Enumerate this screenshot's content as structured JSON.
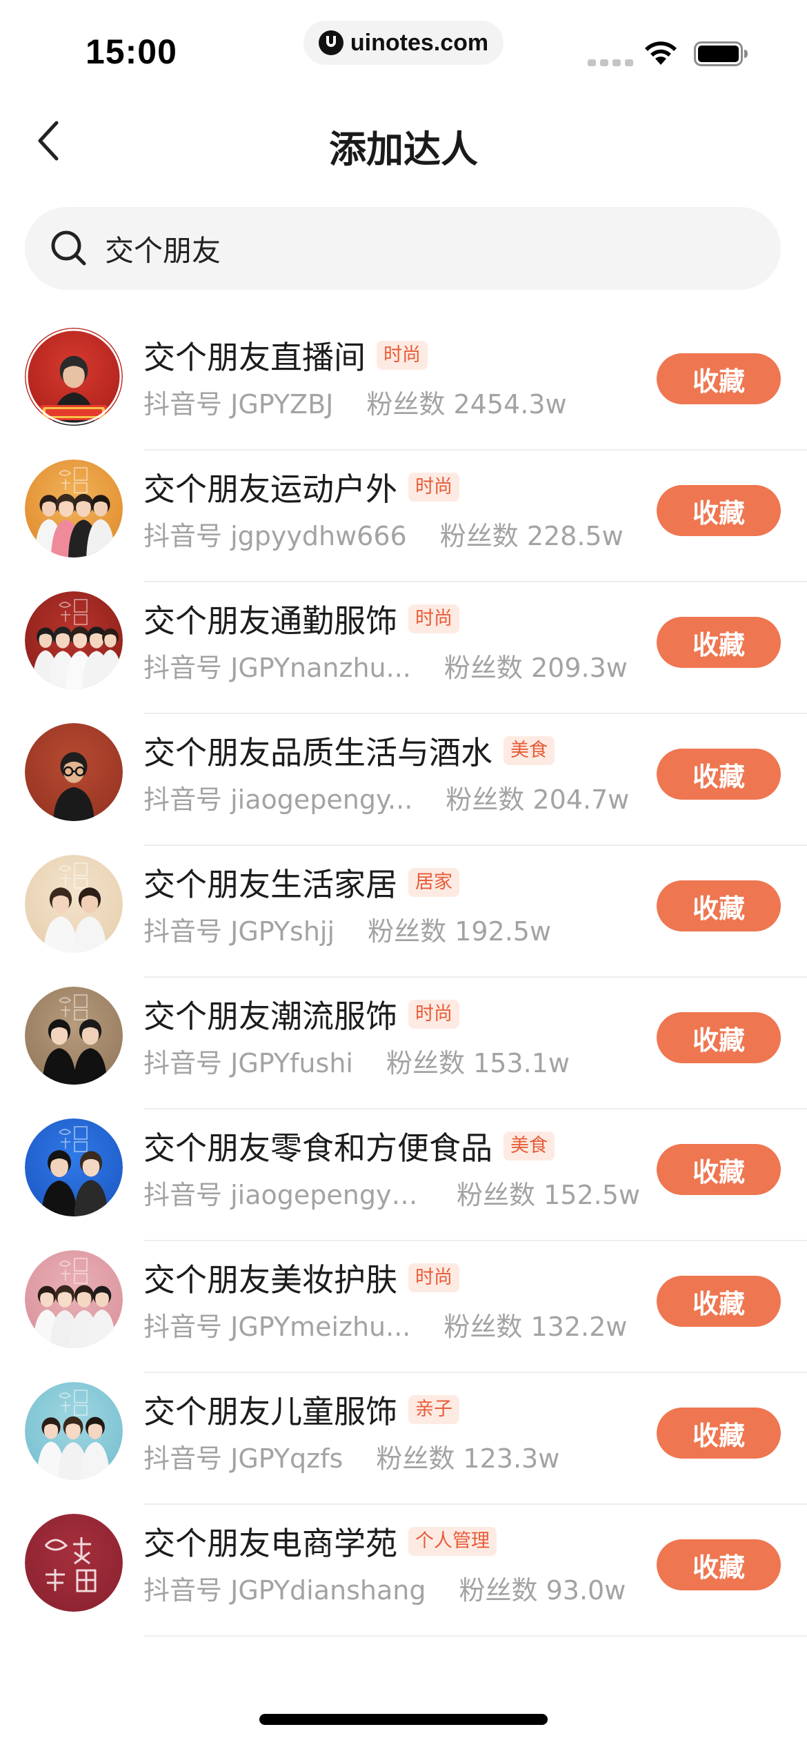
{
  "status_bar": {
    "time": "15:00",
    "url": "uinotes.com"
  },
  "nav": {
    "title": "添加达人"
  },
  "search": {
    "value": "交个朋友"
  },
  "labels": {
    "douyin_prefix": "抖音号",
    "fans_prefix": "粉丝数",
    "collect": "收藏"
  },
  "colors": {
    "accent": "#ee7650",
    "tag_text": "#e85b39",
    "tag_bg": "#fdebe3",
    "meta_text": "#a3a3a3"
  },
  "results": [
    {
      "name": "交个朋友直播间",
      "tag": "时尚",
      "douyin_id": "JGPYZBJ",
      "fans": "2454.3w",
      "avatar": "red-studio"
    },
    {
      "name": "交个朋友运动户外",
      "tag": "时尚",
      "douyin_id": "jgpyydhw666",
      "fans": "228.5w",
      "avatar": "orange-group"
    },
    {
      "name": "交个朋友通勤服饰",
      "tag": "时尚",
      "douyin_id": "JGPYnanzhu...",
      "fans": "209.3w",
      "avatar": "red-group"
    },
    {
      "name": "交个朋友品质生活与酒水",
      "tag": "美食",
      "douyin_id": "jiaogepengy...",
      "fans": "204.7w",
      "avatar": "rust-single"
    },
    {
      "name": "交个朋友生活家居",
      "tag": "居家",
      "douyin_id": "JGPYshjj",
      "fans": "192.5w",
      "avatar": "cream-pair"
    },
    {
      "name": "交个朋友潮流服饰",
      "tag": "时尚",
      "douyin_id": "JGPYfushi",
      "fans": "153.1w",
      "avatar": "brown-pair"
    },
    {
      "name": "交个朋友零食和方便食品",
      "tag": "美食",
      "douyin_id": "jiaogepengyo...",
      "fans": "152.5w",
      "avatar": "blue-pair"
    },
    {
      "name": "交个朋友美妆护肤",
      "tag": "时尚",
      "douyin_id": "JGPYmeizhu...",
      "fans": "132.2w",
      "avatar": "pink-group"
    },
    {
      "name": "交个朋友儿童服饰",
      "tag": "亲子",
      "douyin_id": "JGPYqzfs",
      "fans": "123.3w",
      "avatar": "cyan-group"
    },
    {
      "name": "交个朋友电商学苑",
      "tag": "个人管理",
      "douyin_id": "JGPYdianshang",
      "fans": "93.0w",
      "avatar": "maroon-logo"
    }
  ]
}
